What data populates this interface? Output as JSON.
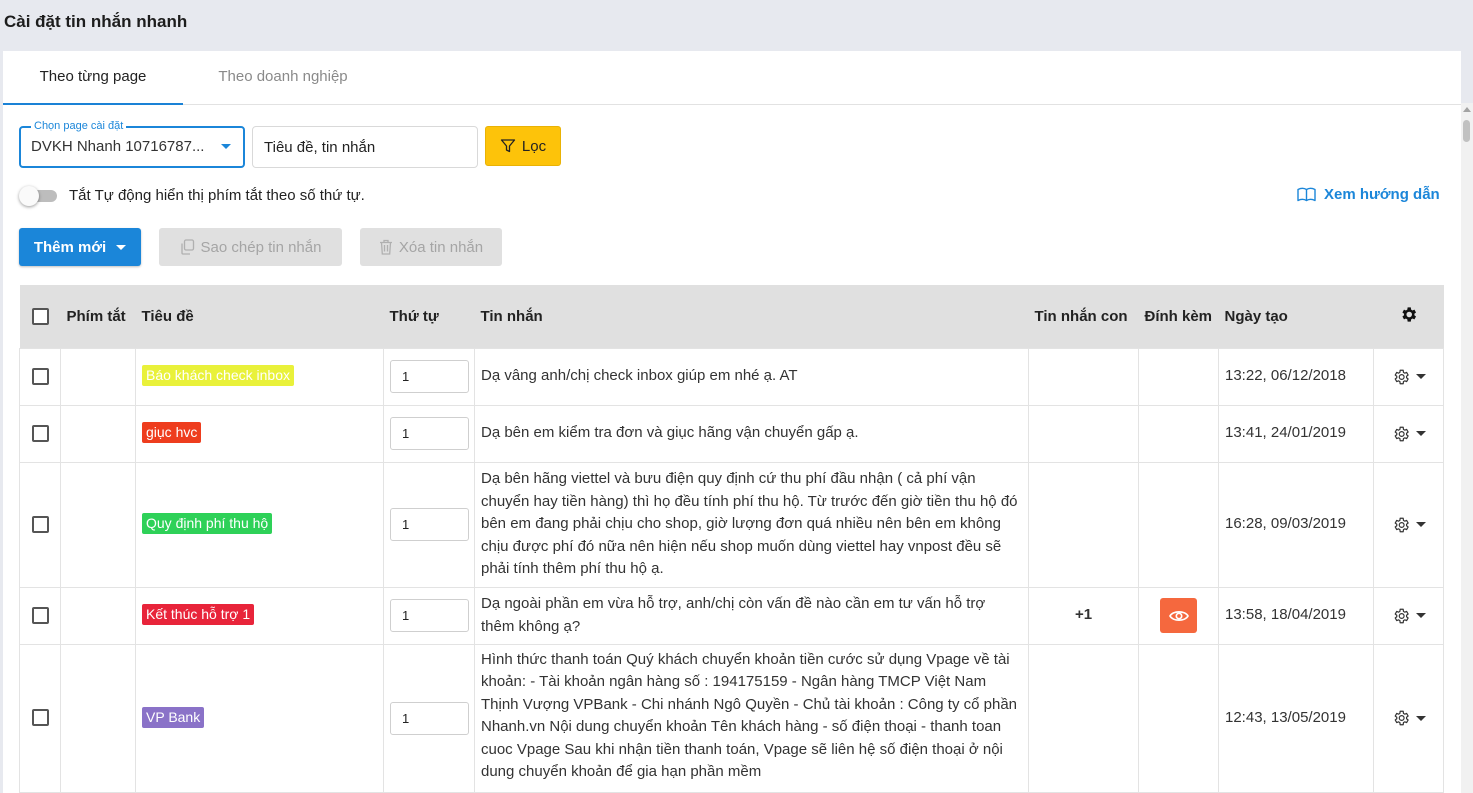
{
  "page": {
    "title": "Cài đặt tin nhắn nhanh"
  },
  "tabs": [
    {
      "label": "Theo từng page",
      "active": true
    },
    {
      "label": "Theo doanh nghiệp",
      "active": false
    }
  ],
  "filters": {
    "page_select_label": "Chọn page cài đặt",
    "page_select_value": "DVKH Nhanh 10716787...",
    "search_placeholder": "Tiêu đề, tin nhắn",
    "filter_label": "Lọc"
  },
  "toggle": {
    "label": "Tắt Tự động hiển thị phím tắt theo số thứ tự.",
    "on": false
  },
  "guide_link": {
    "label": "Xem hướng dẫn"
  },
  "actions": {
    "add_label": "Thêm mới",
    "copy_label": "Sao chép tin nhắn",
    "delete_label": "Xóa tin nhắn"
  },
  "table": {
    "columns": {
      "shortcut": "Phím tắt",
      "title": "Tiêu đề",
      "order": "Thứ tự",
      "message": "Tin nhắn",
      "sub_messages": "Tin nhắn con",
      "attachment": "Đính kèm",
      "created": "Ngày tạo"
    },
    "rows": [
      {
        "shortcut": "",
        "title": "Báo khách check inbox",
        "tag_bg": "#e9f13a",
        "tag_fg": "#ffffff",
        "order": "1",
        "message": "Dạ vâng anh/chị check inbox giúp em nhé ạ. AT",
        "sub_messages": "",
        "attachment": false,
        "created": "13:22, 06/12/2018"
      },
      {
        "shortcut": "",
        "title": "giục hvc",
        "tag_bg": "#ee3d1e",
        "tag_fg": "#ffffff",
        "order": "1",
        "message": "Dạ bên em kiểm tra đơn và giục hãng vận chuyển gấp ạ.",
        "sub_messages": "",
        "attachment": false,
        "created": "13:41, 24/01/2019"
      },
      {
        "shortcut": "",
        "title": "Quy định phí thu hộ",
        "tag_bg": "#2ed158",
        "tag_fg": "#ffffff",
        "order": "1",
        "message": "Dạ bên hãng viettel và bưu điện quy định cứ thu phí đầu nhận ( cả phí vận chuyển hay tiền hàng) thì họ đều tính phí thu hộ. Từ trước đến giờ tiền thu hộ đó bên em đang phải chịu cho shop, giờ lượng đơn quá nhiều nên bên em không chịu được phí đó nữa nên hiện nếu shop muốn dùng viettel hay vnpost đều sẽ phải tính thêm phí thu hộ ạ.",
        "sub_messages": "",
        "attachment": false,
        "created": "16:28, 09/03/2019"
      },
      {
        "shortcut": "",
        "title": "Kết thúc hỗ trợ 1",
        "tag_bg": "#e8243a",
        "tag_fg": "#ffffff",
        "order": "1",
        "message": "Dạ ngoài phần em vừa hỗ trợ, anh/chị còn vấn đề nào cần em tư vấn hỗ trợ thêm không ạ?",
        "sub_messages": "+1",
        "attachment": true,
        "created": "13:58, 18/04/2019"
      },
      {
        "shortcut": "",
        "title": "VP Bank",
        "tag_bg": "#8a72c8",
        "tag_fg": "#ffffff",
        "order": "1",
        "message": "Hình thức thanh toán Quý khách chuyển khoản tiền cước sử dụng Vpage về tài khoản: - Tài khoản ngân hàng số : 194175159 - Ngân hàng TMCP Việt Nam Thịnh Vượng VPBank - Chi nhánh Ngô Quyền - Chủ tài khoản : Công ty cổ phần Nhanh.vn Nội dung chuyển khoản Tên khách hàng - số điện thoại - thanh toan cuoc Vpage Sau khi nhận tiền thanh toán, Vpage sẽ liên hệ số điện thoại ở nội dung chuyển khoản để gia hạn phần mềm",
        "sub_messages": "",
        "attachment": false,
        "created": "12:43, 13/05/2019"
      }
    ]
  },
  "colors": {
    "primary": "#1b86d9",
    "filter_button": "#fdc30a",
    "attachment_button": "#f5683e",
    "header_background": "#e7e9ef",
    "table_header": "#e0e0e0"
  },
  "icons": {
    "filter": "funnel-icon",
    "guide": "book-icon",
    "copy": "copy-icon",
    "delete": "trash-icon",
    "column_settings": "gear-icon",
    "row_actions": "gear-outline-icon",
    "attachment": "eye-icon"
  }
}
